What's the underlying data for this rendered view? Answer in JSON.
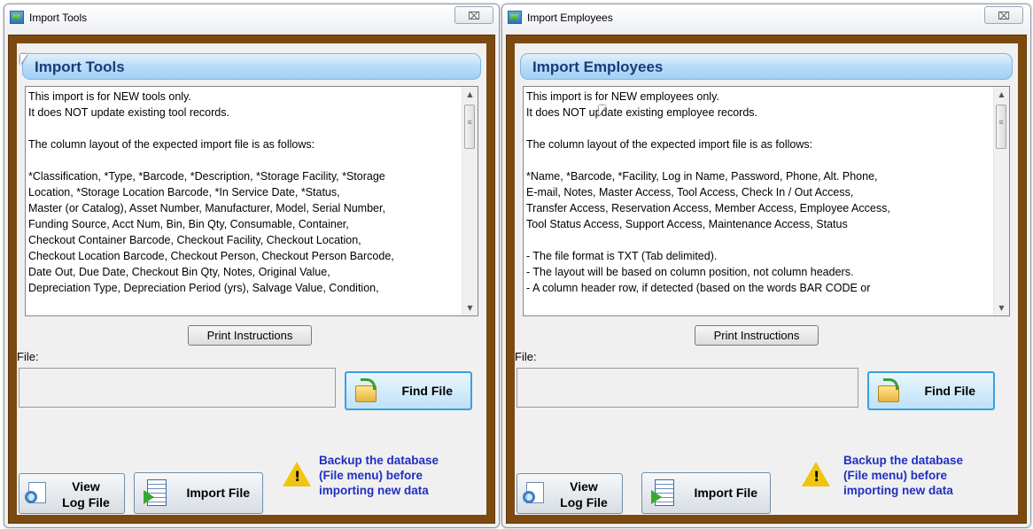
{
  "windows": [
    {
      "title": "Import Tools",
      "close_glyph": "⌧",
      "header": "Import Tools",
      "lines": [
        "This import is for NEW tools only.",
        "It does NOT update existing tool records.",
        "",
        "The column layout of the expected import file is as follows:",
        "",
        "*Classification, *Type, *Barcode, *Description, *Storage Facility, *Storage",
        "Location, *Storage Location Barcode, *In Service Date, *Status,",
        "Master (or Catalog), Asset Number, Manufacturer, Model, Serial Number,",
        "Funding Source, Acct Num, Bin, Bin Qty, Consumable, Container,",
        "Checkout Container Barcode, Checkout Facility, Checkout Location,",
        "Checkout Location Barcode, Checkout Person, Checkout Person Barcode,",
        "Date Out, Due Date, Checkout Bin Qty, Notes, Original Value,",
        "Depreciation Type, Depreciation Period (yrs), Salvage Value, Condition,"
      ],
      "print_label": "Print Instructions",
      "file_label": "File:",
      "file_value": "",
      "find_label": "Find File",
      "view_log_line1": "View",
      "view_log_line2": "Log File",
      "import_label": "Import File",
      "warning_icon": "warning-icon",
      "warning_line1": "Backup the database",
      "warning_line2": "(File menu) before",
      "warning_line3": "importing new data"
    },
    {
      "title": "Import Employees",
      "close_glyph": "⌧",
      "header": "Import Employees",
      "lines": [
        "This import is for NEW employees only.",
        "It does NOT update existing employee records.",
        "",
        "The column layout of the expected import file is as follows:",
        "",
        "*Name, *Barcode, *Facility, Log in Name, Password, Phone, Alt. Phone,",
        "E-mail, Notes, Master Access, Tool Access, Check In / Out Access,",
        "Transfer Access, Reservation Access, Member Access, Employee Access,",
        "Tool Status Access, Support Access, Maintenance Access, Status",
        "",
        "- The file format is TXT (Tab delimited).",
        "- The layout will be based on column position, not column headers.",
        "- A column header row, if detected (based on the words BAR CODE or"
      ],
      "print_label": "Print Instructions",
      "file_label": "File:",
      "file_value": "",
      "find_label": "Find File",
      "view_log_line1": "View",
      "view_log_line2": "Log File",
      "import_label": "Import File",
      "warning_icon": "warning-icon",
      "warning_line1": "Backup the database",
      "warning_line2": "(File menu) before",
      "warning_line3": "importing new data"
    }
  ],
  "colors": {
    "frame": "#7c4a10",
    "header_text": "#1a3b7a",
    "warning_text": "#1f2fc2",
    "find_border": "#3aa0e0"
  }
}
